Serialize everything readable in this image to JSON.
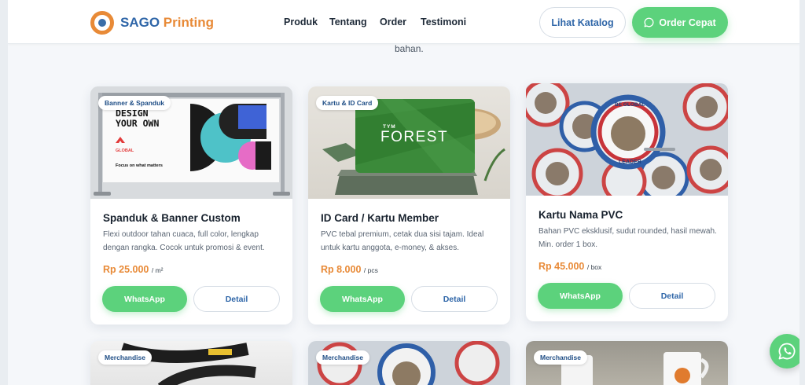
{
  "brand": {
    "name_part1": "SAGO",
    "name_part2": " Printing"
  },
  "nav": {
    "links": [
      "Produk",
      "Tentang",
      "Order",
      "Testimoni"
    ],
    "catalog_label": "Lihat Katalog",
    "order_label": "Order Cepat"
  },
  "hero": {
    "tail_text": "bahan."
  },
  "products": [
    {
      "category": "Banner & Spanduk",
      "title": "Spanduk & Banner Custom",
      "desc": "Flexi outdoor tahan cuaca, full color, lengkap dengan rangka. Cocok untuk promosi & event.",
      "price": "Rp 25.000",
      "unit": "/ m²",
      "wa_label": "WhatsApp",
      "detail_label": "Detail",
      "image": {
        "line1": "DESIGN",
        "line2": "YOUR OWN",
        "logo_text": "GLOBAL",
        "tagline": "Focus on what matters"
      }
    },
    {
      "category": "Kartu & ID Card",
      "title": "ID Card / Kartu Member",
      "desc": "PVC tebal premium, cetak dua sisi tajam. Ideal untuk kartu anggota, e-money, & akses.",
      "price": "Rp 8.000",
      "unit": "/ pcs",
      "wa_label": "WhatsApp",
      "detail_label": "Detail",
      "image": {
        "small": "TYM",
        "big": "FOREST"
      }
    },
    {
      "category": "",
      "title": "Kartu Nama PVC",
      "desc": "Bahan PVC eksklusif, sudut rounded, hasil mewah. Min. order 1 box.",
      "price": "Rp 45.000",
      "unit": "/ box",
      "wa_label": "WhatsApp",
      "detail_label": "Detail",
      "image": {
        "top": "BE GLOBAL",
        "bottom": "LEADER"
      }
    }
  ],
  "more_products": [
    {
      "category": "Merchandise"
    },
    {
      "category": "Merchandise"
    },
    {
      "category": "Merchandise"
    }
  ],
  "colors": {
    "brand_blue": "#2f66a8",
    "brand_orange": "#e88a37",
    "whatsapp_green": "#5cd27c"
  }
}
